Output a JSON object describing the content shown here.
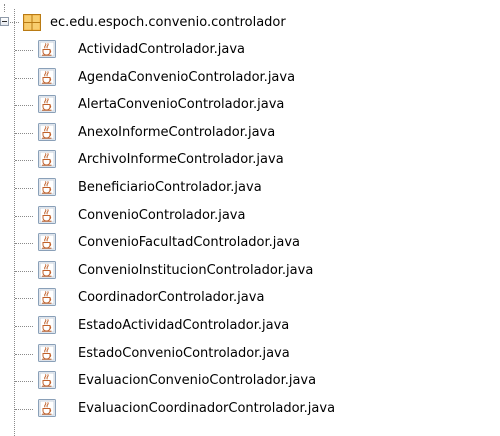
{
  "project_tree": {
    "package": {
      "label": "ec.edu.espoch.convenio.controlador",
      "icon": "package-icon",
      "expanded": true
    },
    "files": [
      {
        "label": "ActividadControlador.java",
        "icon": "java-file-icon"
      },
      {
        "label": "AgendaConvenioControlador.java",
        "icon": "java-file-icon"
      },
      {
        "label": "AlertaConvenioControlador.java",
        "icon": "java-file-icon"
      },
      {
        "label": "AnexoInformeControlador.java",
        "icon": "java-file-icon"
      },
      {
        "label": "ArchivoInformeControlador.java",
        "icon": "java-file-icon"
      },
      {
        "label": "BeneficiarioControlador.java",
        "icon": "java-file-icon"
      },
      {
        "label": "ConvenioControlador.java",
        "icon": "java-file-icon"
      },
      {
        "label": "ConvenioFacultadControlador.java",
        "icon": "java-file-icon"
      },
      {
        "label": "ConvenioInstitucionControlador.java",
        "icon": "java-file-icon"
      },
      {
        "label": "CoordinadorControlador.java",
        "icon": "java-file-icon"
      },
      {
        "label": "EstadoActividadControlador.java",
        "icon": "java-file-icon"
      },
      {
        "label": "EstadoConvenioControlador.java",
        "icon": "java-file-icon"
      },
      {
        "label": "EvaluacionConvenioControlador.java",
        "icon": "java-file-icon"
      },
      {
        "label": "EvaluacionCoordinadorControlador.java",
        "icon": "java-file-icon"
      }
    ]
  },
  "colors": {
    "package_icon": "#e8a52a",
    "file_icon_border": "#8aa0b8",
    "file_icon_fill": "#f3f6fa",
    "java_cup": "#c0612b",
    "tree_lines": "#8a8a8a"
  }
}
